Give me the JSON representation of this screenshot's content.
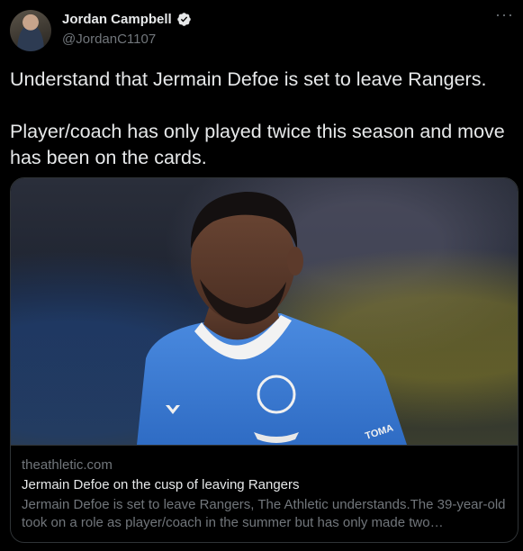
{
  "tweet": {
    "author_name": "Jordan Campbell",
    "author_handle": "@JordanC1107",
    "more_label": "···",
    "paragraphs": [
      "Understand that Jermain Defoe is set to leave Rangers.",
      "Player/coach has only played twice this season and move has been on the cards."
    ]
  },
  "card": {
    "domain": "theathletic.com",
    "title": "Jermain Defoe on the cusp of leaving Rangers",
    "description_line1": "Jermain Defoe is set to leave Rangers, The Athletic understands.The 39-year-old",
    "description_line2": "took on a role as player/coach in the summer but has only made two…",
    "shirt_text": "TOMA"
  },
  "colors": {
    "background": "#000000",
    "text": "#e7e9ea",
    "muted": "#71767b",
    "border": "#2f3336",
    "verified": "#e7e9ea",
    "shirt_blue": "#3f7fd6"
  }
}
